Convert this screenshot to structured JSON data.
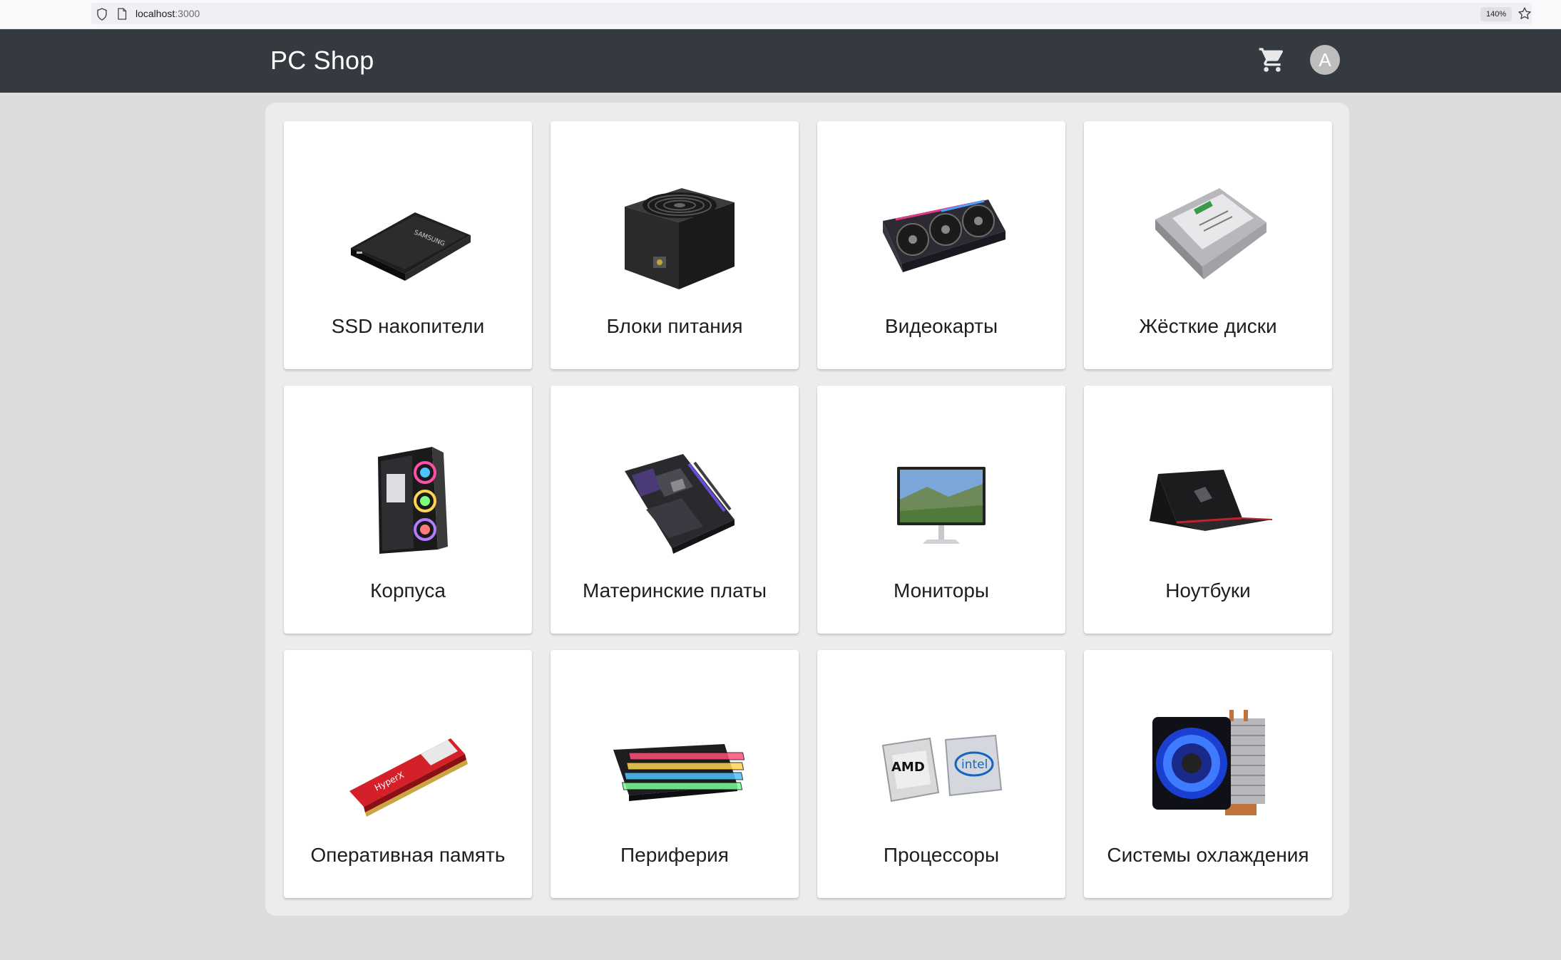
{
  "browser": {
    "url_host": "localhost",
    "url_port": ":3000",
    "zoom": "140%"
  },
  "header": {
    "title": "PC Shop",
    "avatar_letter": "A",
    "cart_icon": "cart-icon"
  },
  "categories": [
    {
      "label": "SSD накопители",
      "icon": "ssd-icon"
    },
    {
      "label": "Блоки питания",
      "icon": "power-supply-icon"
    },
    {
      "label": "Видеокарты",
      "icon": "graphics-card-icon"
    },
    {
      "label": "Жёсткие диски",
      "icon": "hard-drive-icon"
    },
    {
      "label": "Корпуса",
      "icon": "pc-case-icon"
    },
    {
      "label": "Материнские платы",
      "icon": "motherboard-icon"
    },
    {
      "label": "Мониторы",
      "icon": "monitor-icon"
    },
    {
      "label": "Ноутбуки",
      "icon": "laptop-icon"
    },
    {
      "label": "Оперативная память",
      "icon": "ram-icon"
    },
    {
      "label": "Периферия",
      "icon": "keyboard-icon"
    },
    {
      "label": "Процессоры",
      "icon": "cpu-icon"
    },
    {
      "label": "Системы охлаждения",
      "icon": "cooler-icon"
    }
  ],
  "colors": {
    "header_bg": "#343a40",
    "page_bg": "#dcdcdc",
    "panel_bg": "#ececec",
    "card_bg": "#ffffff"
  }
}
